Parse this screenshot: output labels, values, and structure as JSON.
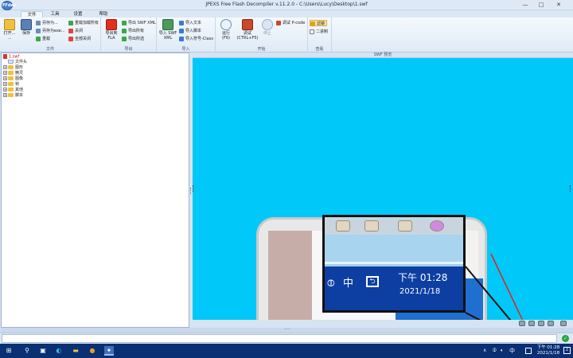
{
  "window": {
    "title": "JPEXS Free Flash Decompiler v.11.2.0 - C:\\Users\\Lucy\\Desktop\\1.swf",
    "logo": "FFdec"
  },
  "colors": {
    "preview_bg": "#00c8f8",
    "taskbar": "#0b2f73",
    "accent_red": "#e8201a"
  },
  "tabs": [
    {
      "label": "文件"
    },
    {
      "label": "工具"
    },
    {
      "label": "设置"
    },
    {
      "label": "帮助"
    }
  ],
  "ribbon": {
    "groups": [
      {
        "label": "文件"
      },
      {
        "label": "导出"
      },
      {
        "label": "导入"
      },
      {
        "label": "开始"
      },
      {
        "label": "查看"
      }
    ],
    "file": {
      "open": "打开...",
      "open_sub": "...",
      "save": "保存",
      "save_as": "另存为...",
      "save_as_exe": "另存为exe...",
      "reload": "重载",
      "reload_all": "重载加载所有",
      "close": "关闭",
      "close_all": "全部关闭"
    },
    "export": {
      "to_fla": "导出到",
      "fla": "FLA",
      "swf_xml": "导出 SWF XML",
      "all": "导出所有",
      "selected": "导出所选"
    },
    "import": {
      "swf_xml": "导入 SWF",
      "xml": "XML",
      "text": "导入文本",
      "script": "导入脚本",
      "symbol_class": "导入符号-Class"
    },
    "start": {
      "run": "运行",
      "run_key": "(F6)",
      "debug": "调试",
      "debug_key": "(CTRL+F5)",
      "stop": "停止",
      "debug_pcode": "调试 P-code"
    },
    "view": {
      "filter": "滤镜",
      "hex": "二进制"
    }
  },
  "tree": {
    "root": "1.swf",
    "items": [
      "文件头",
      "图形",
      "精灵",
      "图像",
      "帧",
      "其他",
      "脚本"
    ]
  },
  "preview": {
    "header": "SWF 预览"
  },
  "callout": {
    "ime": "中",
    "time": "下午 01:28",
    "date": "2021/1/18"
  },
  "taskbar": {
    "time": "下午 01:28",
    "date": "2021/1/18",
    "ime": "中",
    "notify_count": "2"
  }
}
